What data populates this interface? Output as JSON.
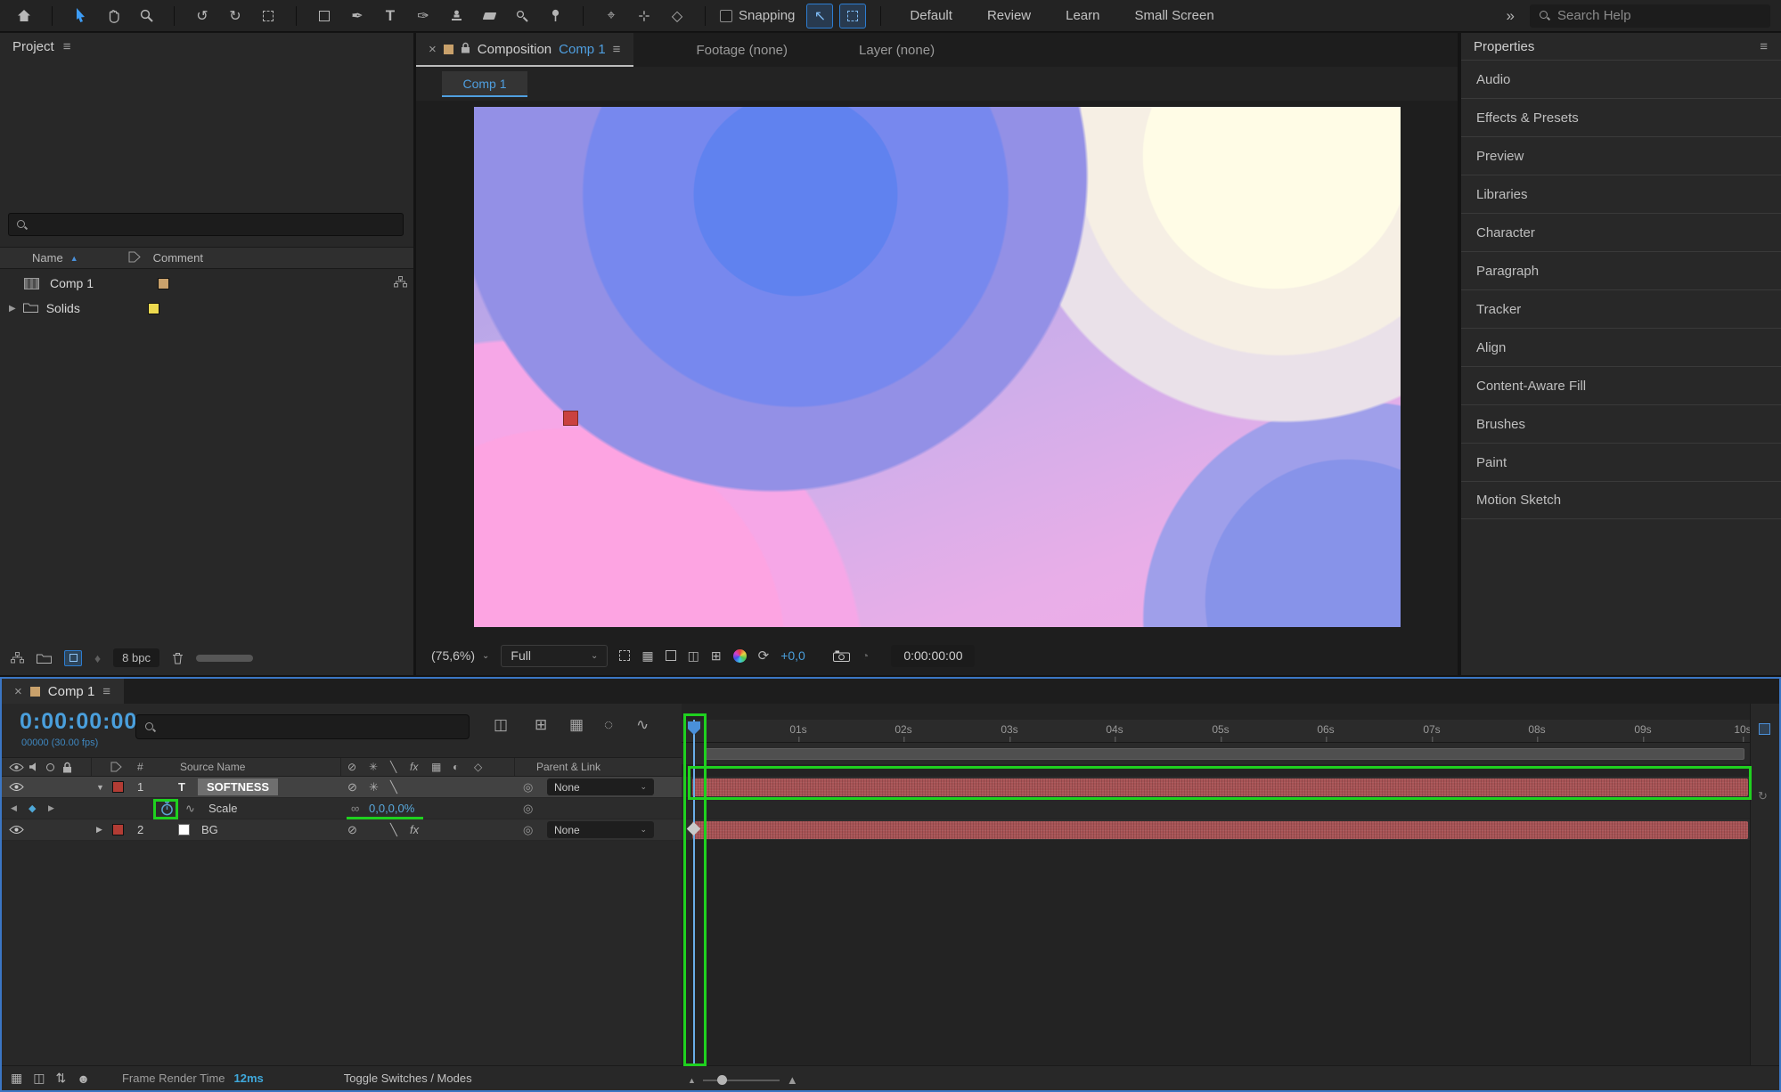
{
  "colors": {
    "accent_blue": "#4a9fdc",
    "annotation_green": "#1fd11f",
    "layer_bar_red": "#a85355",
    "layer_label_red": "#b23c34",
    "label_tan": "#c9a16b",
    "label_yellow": "#ecd94f"
  },
  "toolbar": {
    "snapping_label": "Snapping",
    "workspaces": [
      "Default",
      "Review",
      "Learn",
      "Small Screen"
    ],
    "overflow": "»",
    "search_placeholder": "Search Help"
  },
  "project": {
    "title": "Project",
    "columns": {
      "name": "Name",
      "comment": "Comment"
    },
    "rows": [
      {
        "name": "Comp 1",
        "type": "composition"
      },
      {
        "name": "Solids",
        "type": "folder"
      }
    ],
    "depth_label": "8 bpc"
  },
  "viewer": {
    "tabs": {
      "composition_prefix": "Composition",
      "composition_name": "Comp 1",
      "footage": "Footage (none)",
      "layer": "Layer (none)"
    },
    "subtab": "Comp 1",
    "zoom_value": "(75,6%)",
    "resolution": "Full",
    "exposure": "+0,0",
    "timecode": "0:00:00:00"
  },
  "properties": {
    "title": "Properties",
    "items": [
      "Audio",
      "Effects & Presets",
      "Preview",
      "Libraries",
      "Character",
      "Paragraph",
      "Tracker",
      "Align",
      "Content-Aware Fill",
      "Brushes",
      "Paint",
      "Motion Sketch"
    ]
  },
  "timeline": {
    "tab": "Comp 1",
    "timecode": "0:00:00:00",
    "frame_info": "00000 (30.00 fps)",
    "header": {
      "number": "#",
      "source_name": "Source Name",
      "parent_link": "Parent & Link"
    },
    "layers": [
      {
        "index": "1",
        "type_icon": "T",
        "name": "SOFTNESS",
        "parent": "None"
      },
      {
        "index": "2",
        "name": "BG",
        "parent": "None"
      }
    ],
    "property_row": {
      "label": "Scale",
      "value": "0,0,0,0%"
    },
    "switches": {
      "fx": "fx"
    },
    "ruler": [
      "01s",
      "02s",
      "03s",
      "04s",
      "05s",
      "06s",
      "07s",
      "08s",
      "09s",
      "10s"
    ],
    "footer": {
      "frame_render_label": "Frame Render Time",
      "frame_render_value": "12ms",
      "toggle_label": "Toggle Switches / Modes"
    }
  }
}
